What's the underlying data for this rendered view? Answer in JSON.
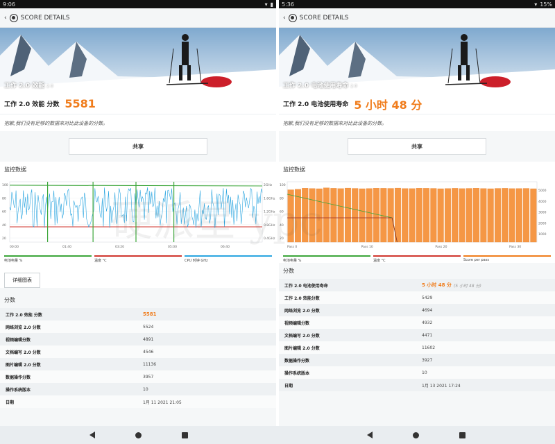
{
  "left": {
    "status": {
      "time": "9:06"
    },
    "title": "SCORE DETAILS",
    "hero_label": "工作 2.0 效能",
    "hero_version": "2.0",
    "score_label": "工作 2.0 效能 分数",
    "score_value": "5581",
    "sorry": "抱歉,我们没有足够的数据来对比此设备的分数。",
    "share": "共享",
    "monitor_title": "监控数据",
    "chart_data": {
      "type": "line",
      "x_ticks": [
        "00:00",
        "01:40",
        "03:20",
        "05:00",
        "06:40"
      ],
      "y_left_ticks": [
        "100",
        "80",
        "60",
        "40",
        "20"
      ],
      "y_right_ticks": [
        "2GHz",
        "1.6GHz",
        "1.2GHz",
        "0.8GHz",
        "0.4GHz"
      ],
      "series": [
        {
          "name": "电池电量 %",
          "color": "#3ca63a",
          "values": [
            100,
            100,
            99,
            99,
            98,
            98
          ]
        },
        {
          "name": "温度 °C",
          "color": "#d0362e",
          "values": [
            32,
            32,
            32,
            32,
            32,
            32
          ]
        },
        {
          "name": "CPU 时钟 GHz",
          "color": "#2aa5e0",
          "values": [
            1.8,
            0.8,
            1.9,
            1.4,
            0.6,
            1.2
          ]
        }
      ]
    },
    "legend": [
      "电池电量 %",
      "温度 °C",
      "CPU 时钟 GHz"
    ],
    "detail_button": "详细图表",
    "scores_title": "分数",
    "scores": [
      {
        "name": "工作 2.0 效能 分数",
        "value": "5581"
      },
      {
        "name": "网络浏览 2.0 分数",
        "value": "5524"
      },
      {
        "name": "视频编辑分数",
        "value": "4891"
      },
      {
        "name": "文档编写 2.0 分数",
        "value": "4546"
      },
      {
        "name": "图片编辑 2.0 分数",
        "value": "11136"
      },
      {
        "name": "数据操作分数",
        "value": "3957"
      },
      {
        "name": "操作系统版本",
        "value": "10"
      },
      {
        "name": "日期",
        "value": "1月 11 2021 21:05"
      }
    ]
  },
  "right": {
    "status": {
      "time": "5:36",
      "battery": "15%"
    },
    "title": "SCORE DETAILS",
    "hero_label": "工作 2.0 电池使用寿命",
    "hero_version": "2.0",
    "score_label": "工作 2.0 电池使用寿命",
    "score_value": "5 小时 48 分",
    "sorry": "抱歉,我们没有足够的数据来对比此设备的分数。",
    "share": "共享",
    "monitor_title": "监控数据",
    "chart_data": {
      "type": "bar",
      "x_ticks": [
        "Pass 0",
        "Pass 10",
        "Pass 20",
        "Pass 30"
      ],
      "y_left_ticks": [
        "100",
        "80",
        "60",
        "40",
        "20"
      ],
      "y_right_ticks": [
        "5000",
        "4000",
        "3000",
        "2000",
        "1000"
      ],
      "bar_values": [
        4900,
        4950,
        5050,
        5020,
        5000,
        5080,
        5040,
        5010,
        5060,
        5030,
        5000,
        5020,
        5050,
        5040,
        5030,
        5060,
        5020,
        5010,
        5050,
        5040,
        5030,
        5000,
        5020,
        5040,
        5010,
        5030,
        5050,
        5020,
        5000,
        5030,
        5040,
        5010,
        5020,
        5030,
        5000
      ],
      "series": [
        {
          "name": "电池电量 %",
          "color": "#3ca63a"
        },
        {
          "name": "温度 °C",
          "color": "#d0362e"
        },
        {
          "name": "Score per pass",
          "color": "#f07c1b"
        }
      ]
    },
    "legend": [
      "电池电量 %",
      "温度 °C",
      "Score per pass"
    ],
    "scores_title": "分数",
    "scores": [
      {
        "name": "工作 2.0 电池使用寿命",
        "value": "5 小时 48 分",
        "sub": "(5 小时 48 分)"
      },
      {
        "name": "工作 2.0 效能分数",
        "value": "5429"
      },
      {
        "name": "网络浏览 2.0 分数",
        "value": "4694"
      },
      {
        "name": "视频编辑分数",
        "value": "4932"
      },
      {
        "name": "文档编写 2.0 分数",
        "value": "4471"
      },
      {
        "name": "图片编辑 2.0 分数",
        "value": "11602"
      },
      {
        "name": "数据操作分数",
        "value": "3927"
      },
      {
        "name": "操作系统版本",
        "value": "10"
      },
      {
        "name": "日期",
        "value": "1月 13 2021 17:24"
      }
    ]
  },
  "watermark": "硬派星 ypc"
}
